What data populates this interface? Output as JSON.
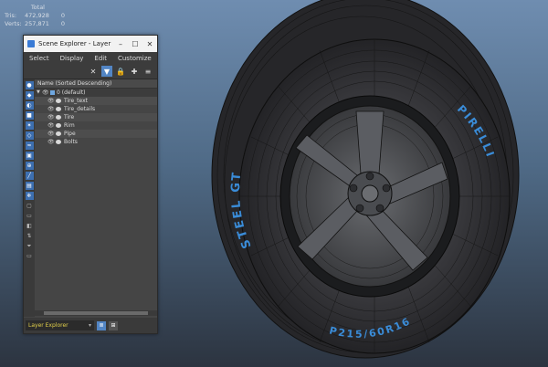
{
  "stats": {
    "rows": [
      {
        "label": "",
        "v1": "Total",
        "v2": ""
      },
      {
        "label": "Tris:",
        "v1": "472,928",
        "v2": "0"
      },
      {
        "label": "Verts:",
        "v1": "257,871",
        "v2": "0"
      }
    ]
  },
  "tire": {
    "sidewall_text_left": "STEEL GT",
    "sidewall_text_right": "PIRELLI",
    "sidewall_text_bottom": "P215/60R16",
    "colors": {
      "rubber": "#2a2a2d",
      "mesh": "#151515",
      "label": "#3a8cd8",
      "rim": "#4a4c50"
    }
  },
  "scene_explorer": {
    "title": "Scene Explorer - Layer E...",
    "window_buttons": {
      "minimize": "–",
      "maximize": "☐",
      "close": "✕"
    },
    "menu": [
      "Select",
      "Display",
      "Edit",
      "Customize"
    ],
    "column_header": "Name (Sorted Descending)",
    "root": "0 (default)",
    "layers": [
      "Tire_text",
      "Tire_details",
      "Tire",
      "Rim",
      "Pipe",
      "Bolts"
    ],
    "bottom": {
      "dropdown": "Layer Explorer"
    }
  }
}
